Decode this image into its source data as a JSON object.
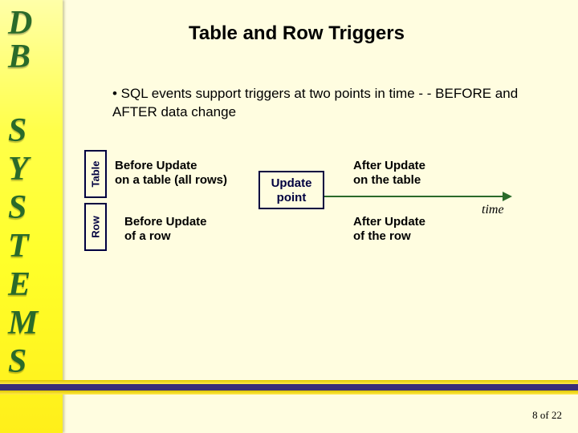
{
  "brand": {
    "d": "D",
    "b": "B",
    "s1": "S",
    "y": "Y",
    "s2": "S",
    "t": "T",
    "e": "E",
    "m": "M",
    "s3": "S"
  },
  "title": "Table and Row Triggers",
  "bullet": "• SQL events support triggers at two points in time - - BEFORE and AFTER data change",
  "labels": {
    "table_box": "Table",
    "row_box": "Row",
    "before_table": "Before Update\non a table (all rows)",
    "before_row": "Before Update\nof a row",
    "after_table": "After Update\non the table",
    "after_row": "After Update\nof the row",
    "update_point": "Update\npoint",
    "time": "time"
  },
  "pager": "8 of 22"
}
